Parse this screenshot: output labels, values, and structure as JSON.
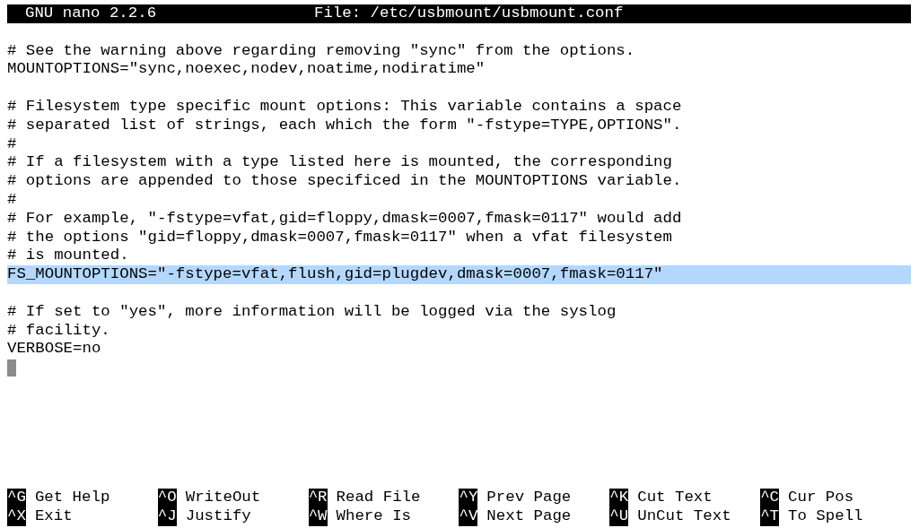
{
  "title_bar": {
    "app": "GNU nano 2.2.6",
    "file": "File: /etc/usbmount/usbmount.conf"
  },
  "editor": {
    "blocks": [
      {
        "lines": [
          {
            "text": "# See the warning above regarding removing \"sync\" from the options.",
            "selected": false
          },
          {
            "text": "MOUNTOPTIONS=\"sync,noexec,nodev,noatime,nodiratime\"",
            "selected": false
          }
        ]
      },
      {
        "lines": [
          {
            "text": "# Filesystem type specific mount options: This variable contains a space",
            "selected": false
          },
          {
            "text": "# separated list of strings, each which the form \"-fstype=TYPE,OPTIONS\".",
            "selected": false
          },
          {
            "text": "#",
            "selected": false
          },
          {
            "text": "# If a filesystem with a type listed here is mounted, the corresponding",
            "selected": false
          },
          {
            "text": "# options are appended to those specificed in the MOUNTOPTIONS variable.",
            "selected": false
          },
          {
            "text": "#",
            "selected": false
          },
          {
            "text": "# For example, \"-fstype=vfat,gid=floppy,dmask=0007,fmask=0117\" would add",
            "selected": false
          },
          {
            "text": "# the options \"gid=floppy,dmask=0007,fmask=0117\" when a vfat filesystem",
            "selected": false
          },
          {
            "text": "# is mounted.",
            "selected": false
          },
          {
            "text": "FS_MOUNTOPTIONS=\"-fstype=vfat,flush,gid=plugdev,dmask=0007,fmask=0117\"",
            "selected": true
          }
        ]
      },
      {
        "lines": [
          {
            "text": "# If set to \"yes\", more information will be logged via the syslog",
            "selected": false
          },
          {
            "text": "# facility.",
            "selected": false
          },
          {
            "text": "VERBOSE=no",
            "selected": false
          }
        ]
      }
    ],
    "cursor_visible": true
  },
  "shortcuts": [
    {
      "key": "^G",
      "label": "Get Help"
    },
    {
      "key": "^O",
      "label": "WriteOut"
    },
    {
      "key": "^R",
      "label": "Read File"
    },
    {
      "key": "^Y",
      "label": "Prev Page"
    },
    {
      "key": "^K",
      "label": "Cut Text"
    },
    {
      "key": "^C",
      "label": "Cur Pos"
    },
    {
      "key": "^X",
      "label": "Exit"
    },
    {
      "key": "^J",
      "label": "Justify"
    },
    {
      "key": "^W",
      "label": "Where Is"
    },
    {
      "key": "^V",
      "label": "Next Page"
    },
    {
      "key": "^U",
      "label": "UnCut Text"
    },
    {
      "key": "^T",
      "label": "To Spell"
    }
  ]
}
